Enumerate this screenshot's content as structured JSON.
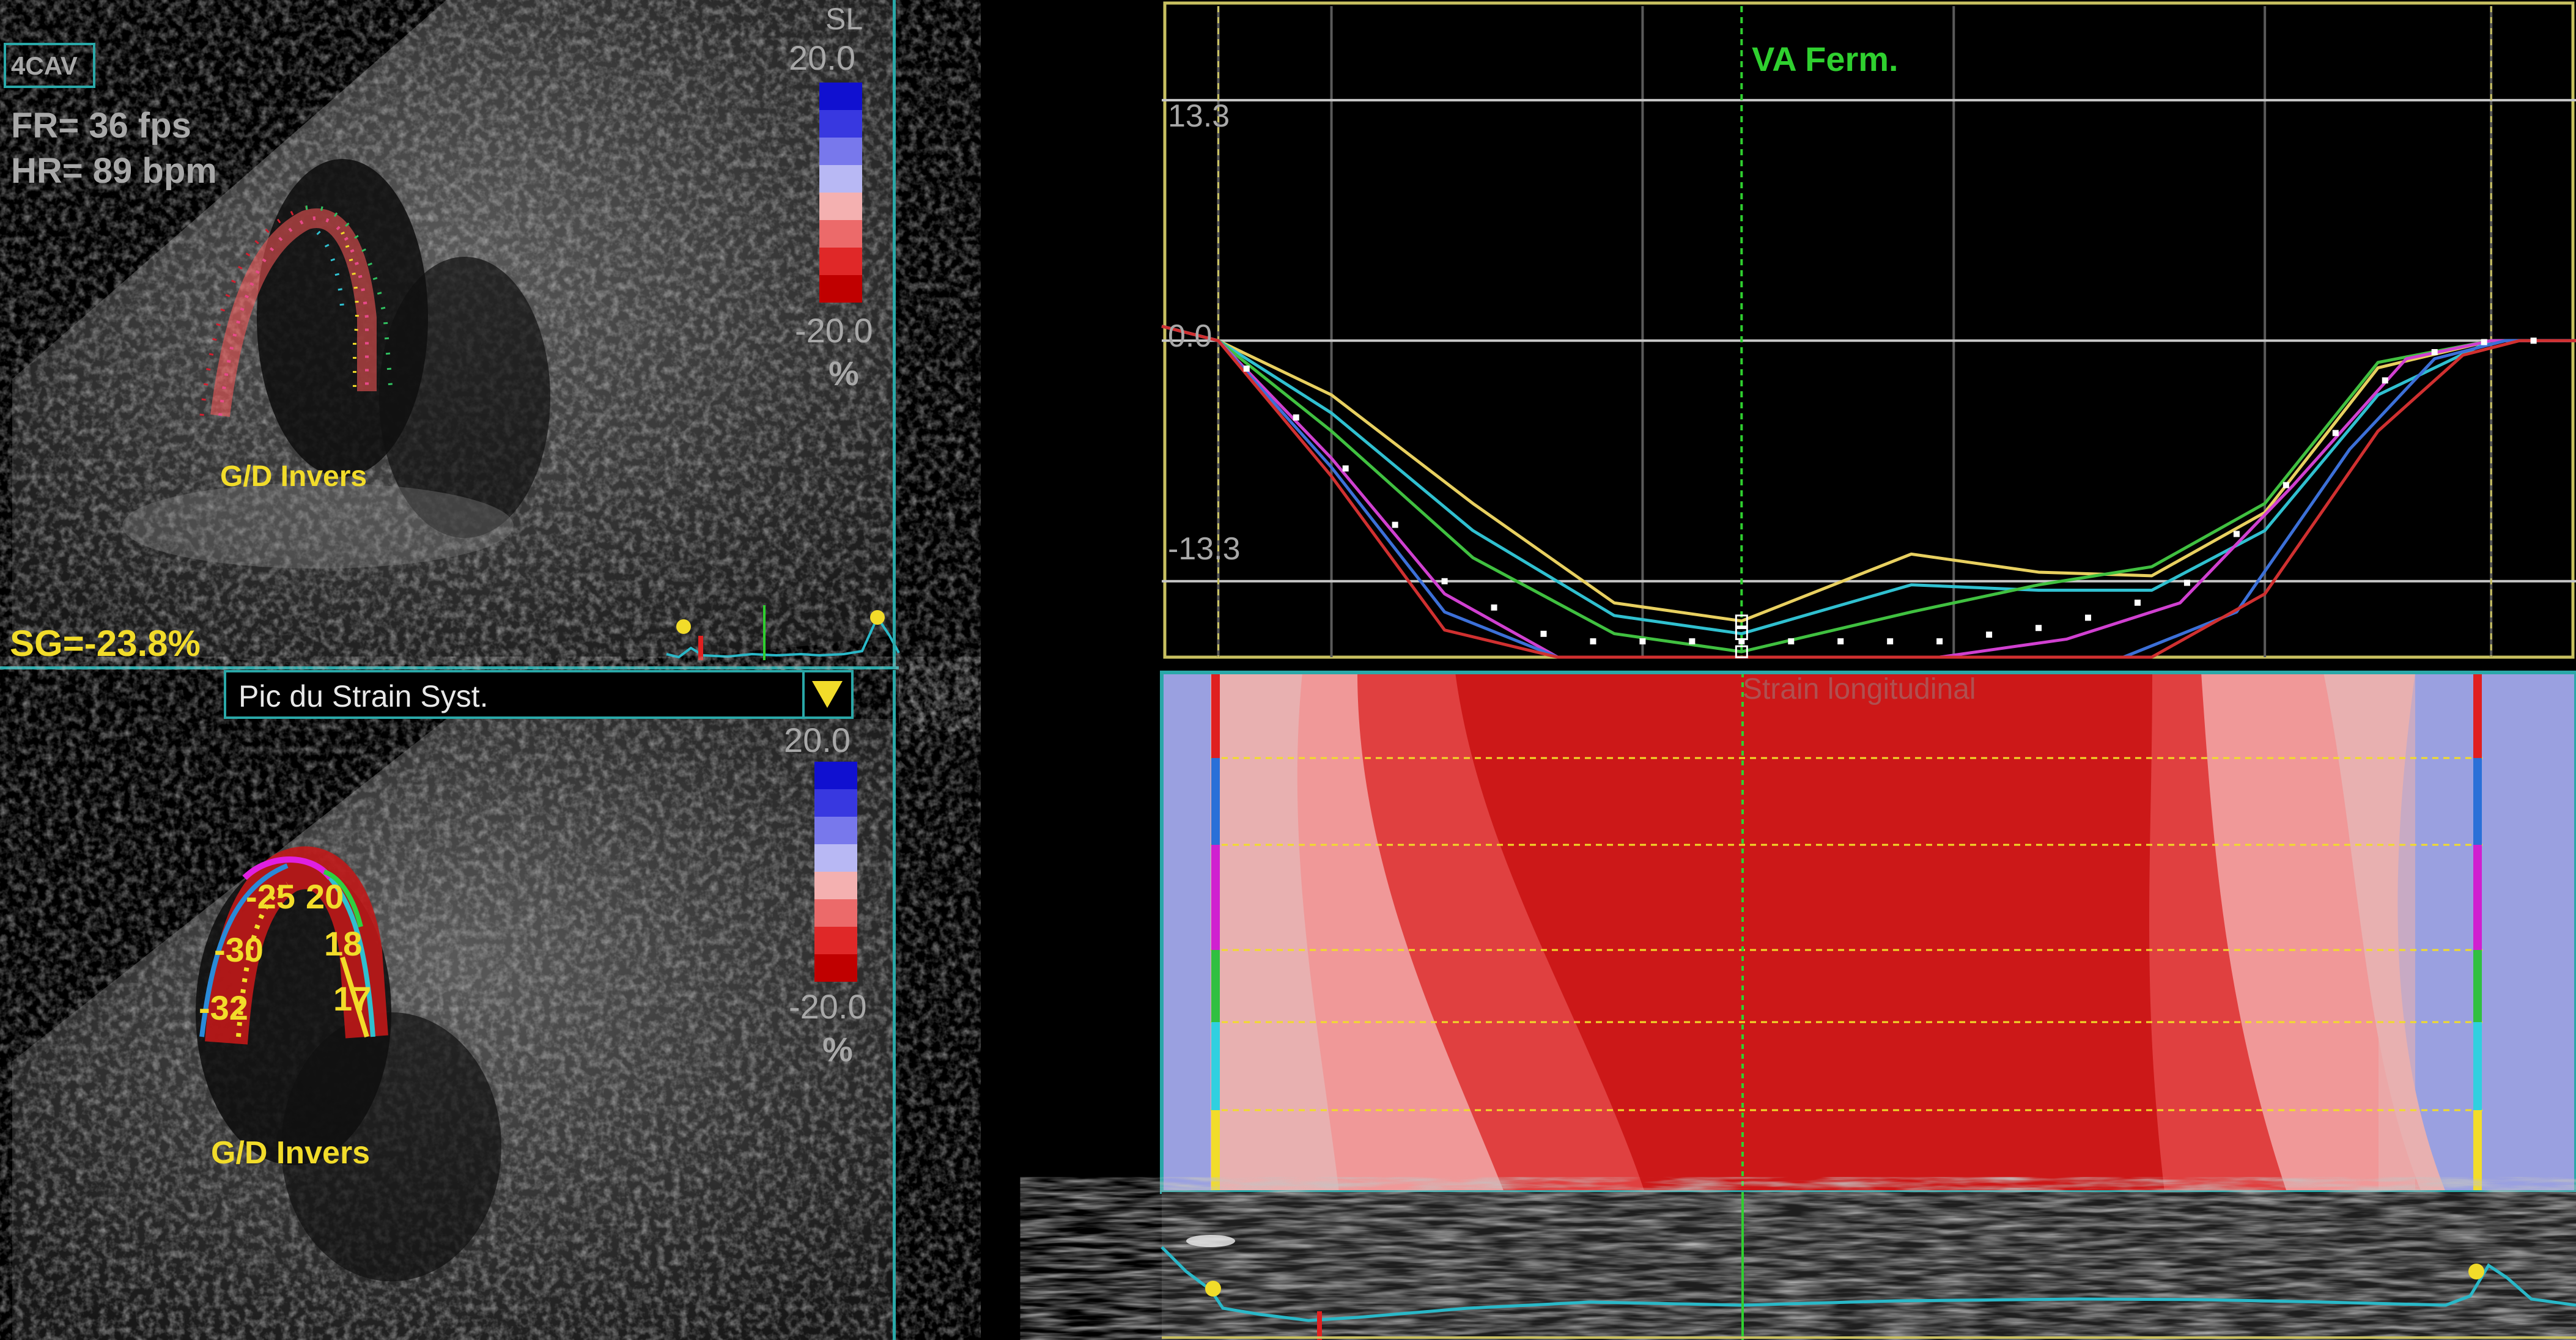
{
  "top_echo": {
    "view_label": "4CAV",
    "fr": "FR= 36 fps",
    "hr": "HR= 89 bpm",
    "scale_title": "SL",
    "scale_max": "20.0",
    "scale_min": "-20.0",
    "scale_unit": "%",
    "orientation": "G/D Invers",
    "global_strain": "SG=-23.8%"
  },
  "bottom_echo": {
    "dropdown_label": "Pic du Strain Syst.",
    "scale_max": "20.0",
    "scale_min": "-20.0",
    "scale_unit": "%",
    "orientation": "G/D Invers",
    "segment_values": [
      "-25",
      "20",
      "-30",
      "18",
      "-32",
      "17"
    ]
  },
  "strain_chart": {
    "event_label": "VA Ferm.",
    "panel_label": "Strain longitudinal",
    "colors": {
      "grid": "#c8c8c8",
      "frame": "#c8c060",
      "event": "#2fd02f"
    }
  },
  "chart_data": {
    "type": "line",
    "title": "",
    "y_ticks": [
      "13.3",
      "0.0",
      "-13.3"
    ],
    "ylim": [
      -17.5,
      18.5
    ],
    "xlim": [
      0,
      1
    ],
    "event_x": 0.41,
    "series": [
      {
        "color": "#e8d060",
        "x": [
          0,
          0.04,
          0.12,
          0.22,
          0.32,
          0.41,
          0.53,
          0.62,
          0.7,
          0.78,
          0.86,
          0.94,
          1
        ],
        "y": [
          0.8,
          0,
          -3,
          -9,
          -14.5,
          -15.5,
          -11.8,
          -12.8,
          -13,
          -9.5,
          -1.5,
          0,
          0
        ]
      },
      {
        "color": "#30c0d0",
        "x": [
          0,
          0.04,
          0.12,
          0.22,
          0.32,
          0.41,
          0.53,
          0.62,
          0.7,
          0.78,
          0.86,
          0.94,
          1
        ],
        "y": [
          0.8,
          0,
          -4,
          -10.5,
          -15.2,
          -16.2,
          -13.5,
          -13.8,
          -13.8,
          -10.5,
          -3,
          0,
          0
        ]
      },
      {
        "color": "#40c040",
        "x": [
          0,
          0.04,
          0.12,
          0.22,
          0.32,
          0.41,
          0.53,
          0.62,
          0.7,
          0.78,
          0.86,
          0.94,
          1
        ],
        "y": [
          0.8,
          0,
          -5,
          -12,
          -16.2,
          -17.2,
          -15,
          -13.5,
          -12.5,
          -9,
          -1.2,
          0,
          0
        ]
      },
      {
        "color": "#d040d0",
        "x": [
          0,
          0.04,
          0.12,
          0.2,
          0.28,
          0.41,
          0.55,
          0.64,
          0.72,
          0.8,
          0.88,
          0.94,
          1
        ],
        "y": [
          0.8,
          0,
          -6.5,
          -14,
          -17.5,
          -17.5,
          -17.5,
          -16.5,
          -14.5,
          -8,
          -1,
          0,
          0
        ]
      },
      {
        "color": "#3c70d8",
        "x": [
          0,
          0.04,
          0.12,
          0.2,
          0.28,
          0.41,
          0.58,
          0.68,
          0.76,
          0.84,
          0.9,
          0.95,
          1
        ],
        "y": [
          0.8,
          0,
          -7,
          -15,
          -17.5,
          -17.5,
          -17.5,
          -17.5,
          -15,
          -6,
          -1,
          0,
          0
        ]
      },
      {
        "color": "#d03030",
        "x": [
          0,
          0.04,
          0.12,
          0.2,
          0.28,
          0.41,
          0.6,
          0.7,
          0.78,
          0.86,
          0.92,
          0.96,
          1
        ],
        "y": [
          0.8,
          0,
          -7.5,
          -16,
          -17.5,
          -17.5,
          -17.5,
          -17.5,
          -14,
          -5,
          -0.8,
          0,
          0
        ]
      }
    ]
  },
  "bottom_trace": {
    "marker_color": "#f2dc2a",
    "line_color": "#2ab8c8"
  }
}
